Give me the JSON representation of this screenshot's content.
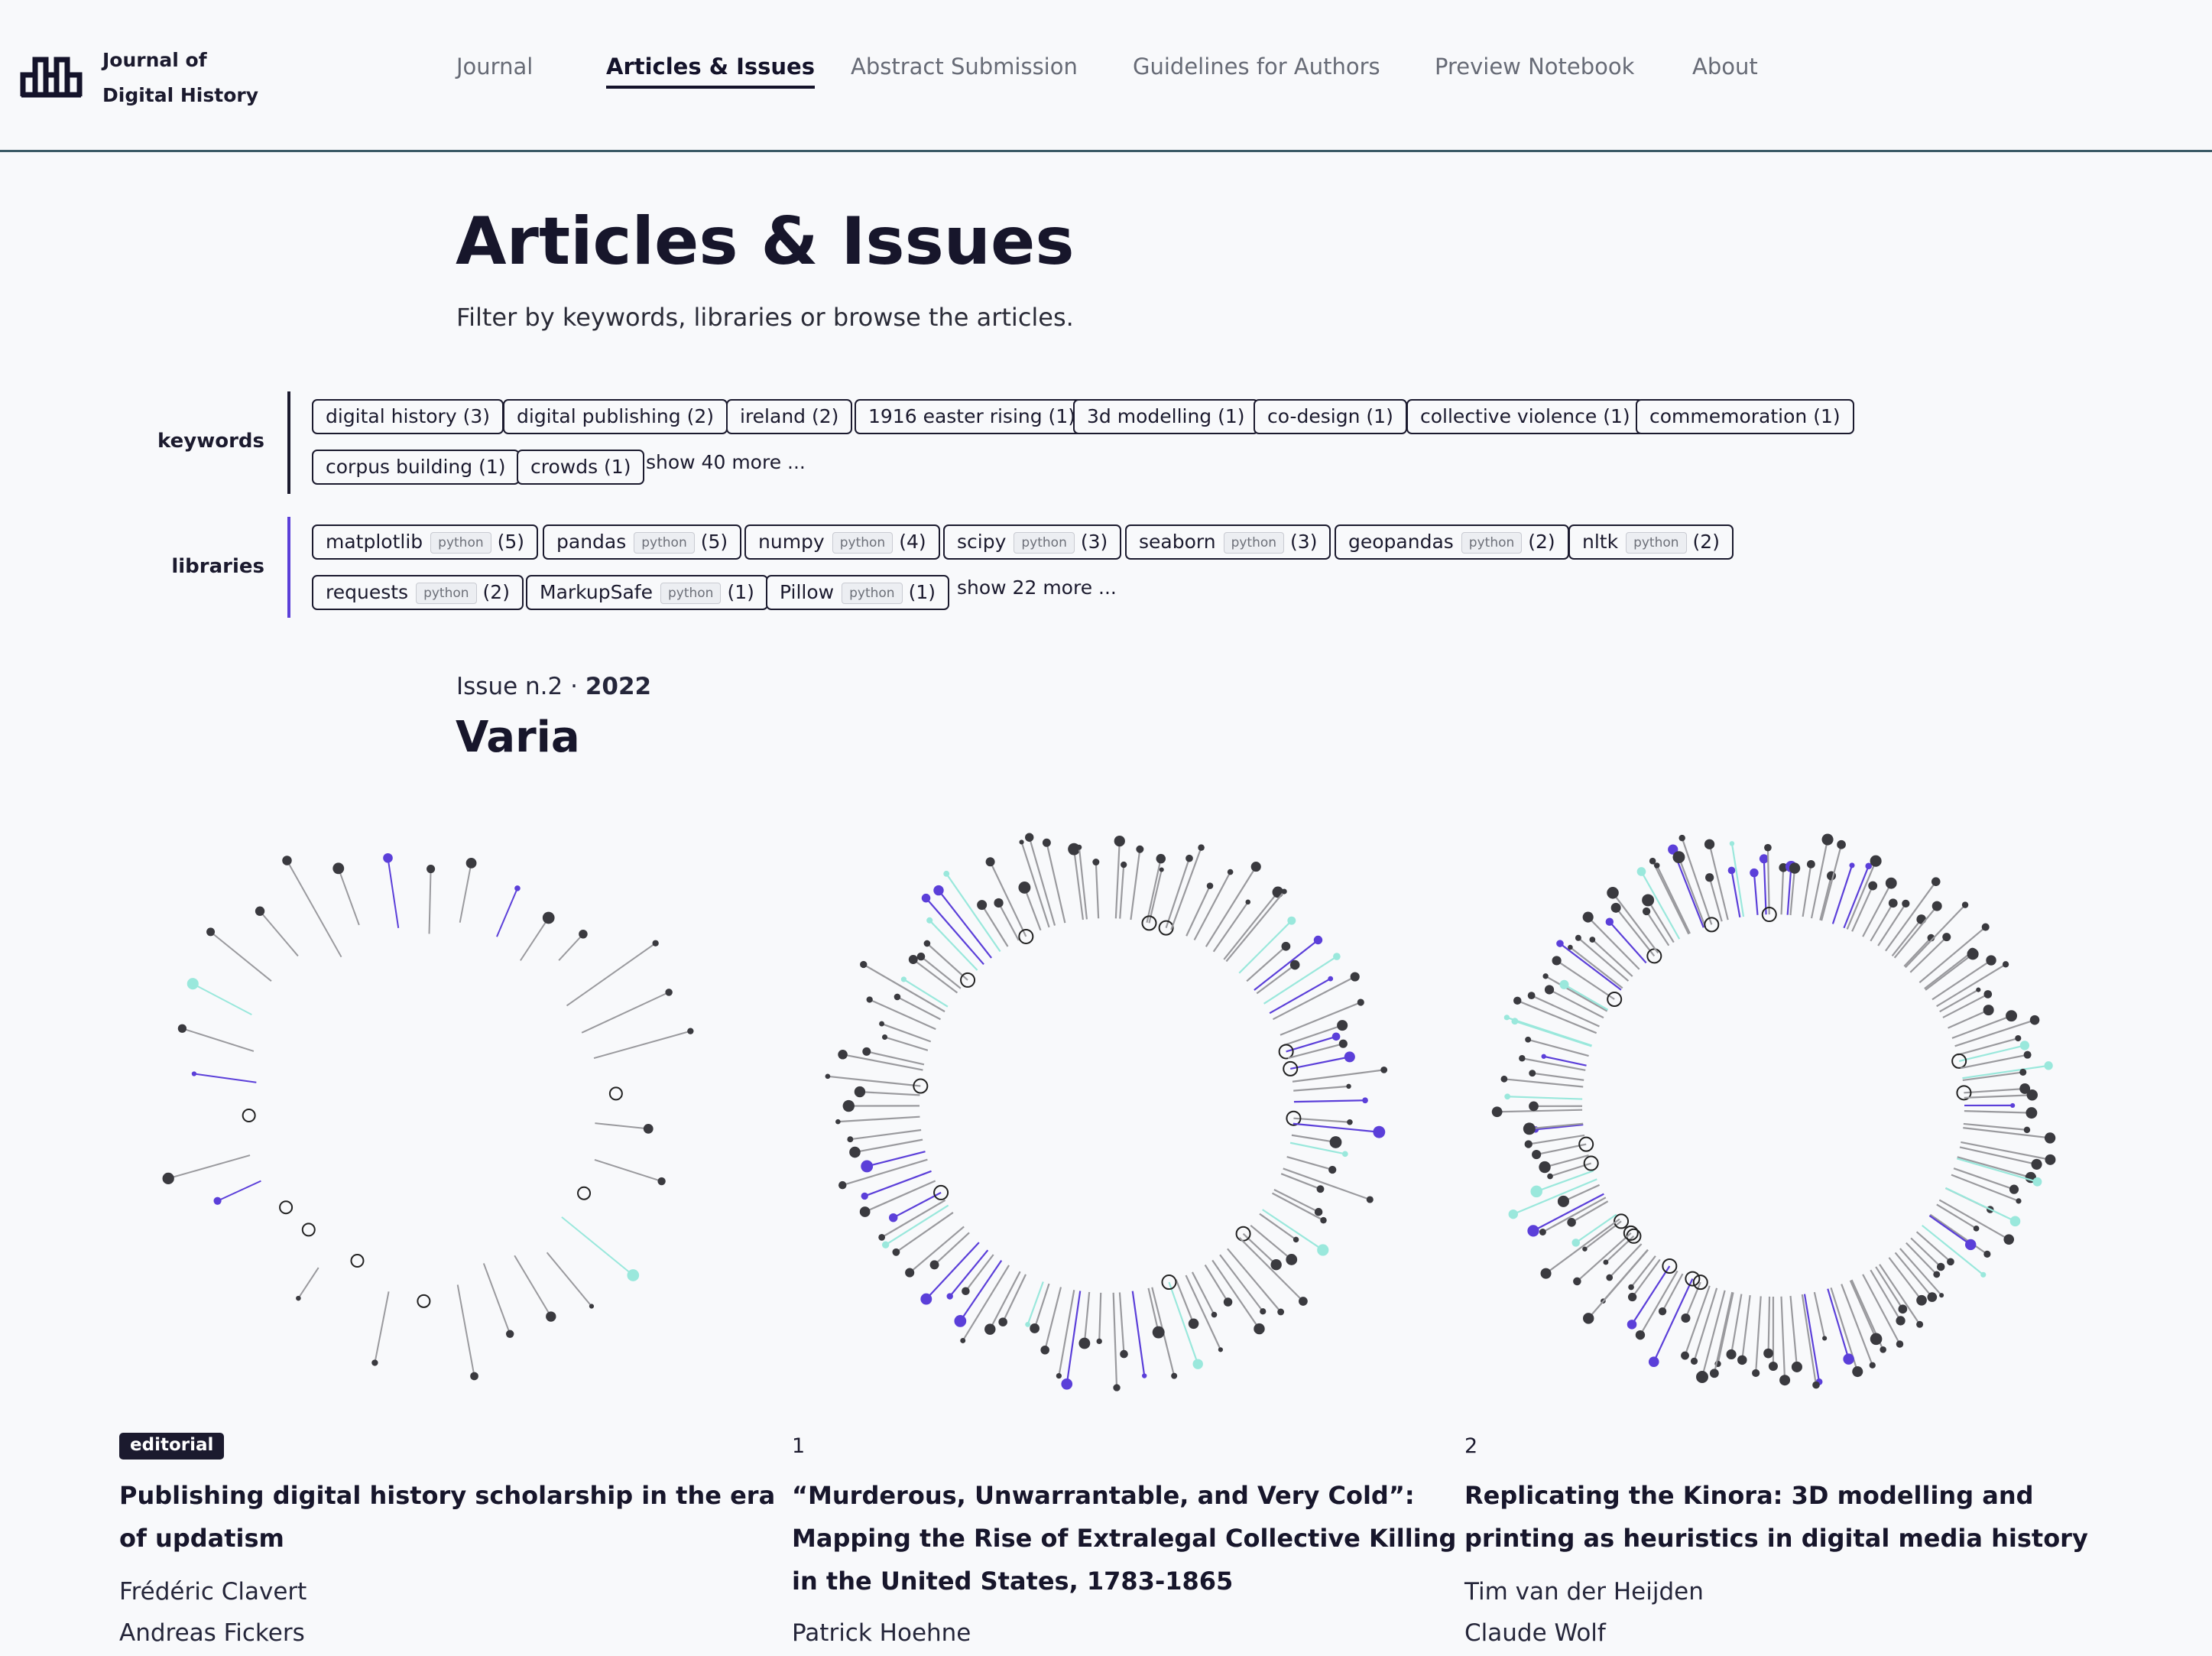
{
  "brand": {
    "line1": "Journal of",
    "line2": "Digital History"
  },
  "nav": [
    {
      "label": "Journal",
      "active": false
    },
    {
      "label": "Articles & Issues",
      "active": true
    },
    {
      "label": "Abstract Submission",
      "active": false
    },
    {
      "label": "Guidelines for Authors",
      "active": false
    },
    {
      "label": "Preview Notebook",
      "active": false
    },
    {
      "label": "About",
      "active": false
    }
  ],
  "page": {
    "title": "Articles & Issues",
    "subtitle": "Filter by keywords, libraries or browse the articles."
  },
  "keywords": {
    "label": "keywords",
    "tags": [
      "digital history (3)",
      "digital publishing (2)",
      "ireland (2)",
      "1916 easter rising (1)",
      "3d modelling (1)",
      "co-design (1)",
      "collective violence (1)",
      "commemoration (1)",
      "corpus building (1)",
      "crowds (1)"
    ],
    "more": "show 40 more ..."
  },
  "libraries": {
    "label": "libraries",
    "tags": [
      {
        "name": "matplotlib",
        "lang": "python",
        "count": "(5)"
      },
      {
        "name": "pandas",
        "lang": "python",
        "count": "(5)"
      },
      {
        "name": "numpy",
        "lang": "python",
        "count": "(4)"
      },
      {
        "name": "scipy",
        "lang": "python",
        "count": "(3)"
      },
      {
        "name": "seaborn",
        "lang": "python",
        "count": "(3)"
      },
      {
        "name": "geopandas",
        "lang": "python",
        "count": "(2)"
      },
      {
        "name": "nltk",
        "lang": "python",
        "count": "(2)"
      },
      {
        "name": "requests",
        "lang": "python",
        "count": "(2)"
      },
      {
        "name": "MarkupSafe",
        "lang": "python",
        "count": "(1)"
      },
      {
        "name": "Pillow",
        "lang": "python",
        "count": "(1)"
      }
    ],
    "more": "show 22 more ..."
  },
  "issue": {
    "prefix": "Issue n.2 · ",
    "year": "2022",
    "title": "Varia"
  },
  "articles": [
    {
      "badge": "editorial",
      "number": "",
      "title": "Publishing digital history scholarship in the era of updatism",
      "authors": [
        "Frédéric Clavert",
        "Andreas Fickers"
      ]
    },
    {
      "badge": "",
      "number": "1",
      "title": "“Murderous, Unwarrantable, and Very Cold”: Mapping the Rise of Extralegal Collective Killing in the United States, 1783-1865",
      "authors": [
        "Patrick Hoehne"
      ]
    },
    {
      "badge": "",
      "number": "2",
      "title": "Replicating the Kinora: 3D modelling and printing as heuristics in digital media history",
      "authors": [
        "Tim van der Heijden",
        "Claude Wolf"
      ]
    }
  ],
  "colors": {
    "accent": "#5b3fd9",
    "teal": "#9ae8dc",
    "dark": "#3a3a3f",
    "grey": "#9a9a9e",
    "libraries_bar": "#5b3fd9",
    "keywords_bar": "#1b1a2e"
  }
}
